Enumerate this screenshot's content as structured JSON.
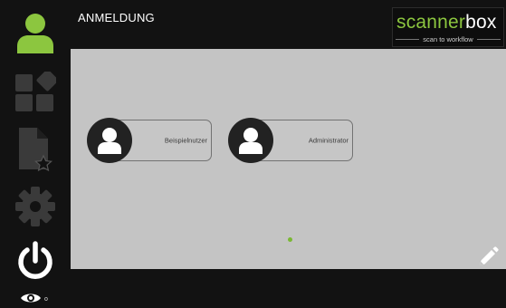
{
  "page": {
    "title": "ANMELDUNG"
  },
  "logo": {
    "text_part1": "scanner",
    "text_part2": "box",
    "tagline": "scan to workflow"
  },
  "sidebar": {
    "items": [
      {
        "name": "user",
        "icon": "user-icon",
        "state": "active"
      },
      {
        "name": "apps",
        "icon": "apps-grid-icon",
        "state": "disabled"
      },
      {
        "name": "favorite-documents",
        "icon": "document-star-icon",
        "state": "disabled"
      },
      {
        "name": "settings",
        "icon": "gear-icon",
        "state": "disabled"
      },
      {
        "name": "power",
        "icon": "power-icon",
        "state": "active"
      }
    ],
    "visibility_mark": "o"
  },
  "users": [
    {
      "label": "Beispielnutzer",
      "icon": "user-avatar-icon"
    },
    {
      "label": "Administrator",
      "icon": "user-avatar-icon"
    }
  ],
  "pagination": {
    "current": 1,
    "total": 1
  },
  "colors": {
    "accent": "#8cc63f",
    "background": "#121212",
    "panel": "#c4c4c4",
    "disabled_icon": "#3a3a3a"
  }
}
